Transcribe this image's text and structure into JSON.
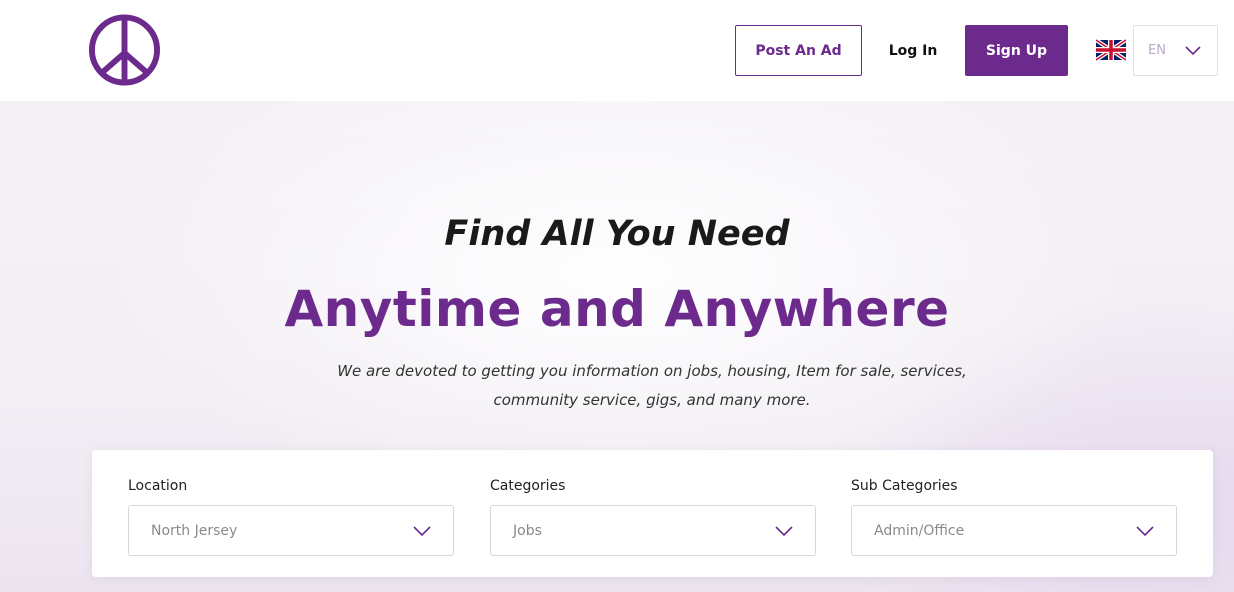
{
  "header": {
    "post_ad_label": "Post An Ad",
    "login_label": "Log In",
    "signup_label": "Sign Up",
    "language": {
      "selected": "EN"
    },
    "brand_color": "#6b2a8c",
    "logo_icon": "peace-sign-icon",
    "flag_icon": "uk-flag-icon"
  },
  "hero": {
    "heading_line1": "Find All You Need",
    "heading_line2": "Anytime and Anywhere",
    "tagline": "We are devoted to getting you information on jobs, housing, Item for sale, services, community service, gigs, and many more."
  },
  "search": {
    "location": {
      "label": "Location",
      "value": "North Jersey"
    },
    "categories": {
      "label": "Categories",
      "value": "Jobs"
    },
    "sub_categories": {
      "label": "Sub Categories",
      "value": "Admin/Office"
    }
  }
}
